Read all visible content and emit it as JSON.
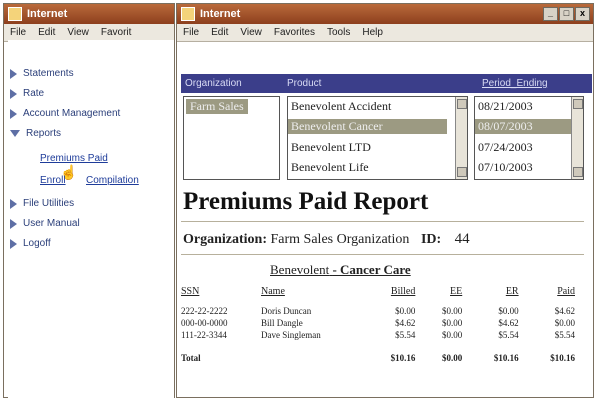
{
  "left_window": {
    "title": "Internet",
    "menu": [
      "File",
      "Edit",
      "View",
      "Favorit"
    ]
  },
  "right_window": {
    "title": "Internet",
    "menu": [
      "File",
      "Edit",
      "View",
      "Favorites",
      "Tools",
      "Help"
    ],
    "controls": [
      "_",
      "□",
      "x"
    ]
  },
  "sidebar": {
    "statements": "Statements",
    "rate": "Rate",
    "account_management": "Account Management",
    "reports": "Reports",
    "premiums_paid": "Premiums Paid",
    "enroll": "Enroll",
    "compilation": "Compilation",
    "file_utilities": "File Utilities",
    "user_manual": "User Manual",
    "logoff": "Logoff"
  },
  "filters": {
    "header": {
      "organization": "Organization",
      "product": "Product",
      "period": "Period_Ending"
    },
    "organization_options": [
      "Farm Sales"
    ],
    "product_options": [
      "Benevolent Accident",
      "Benevolent Cancer",
      "Benevolent LTD",
      "Benevolent Life"
    ],
    "period_options": [
      "08/21/2003",
      "08/07/2003",
      "07/24/2003",
      "07/10/2003"
    ]
  },
  "report": {
    "title": "Premiums Paid Report",
    "org_label": "Organization:",
    "org_value": "Farm Sales Organization",
    "id_label": "ID:",
    "id_value": "44",
    "subtitle_prefix": "Benevolent",
    "subtitle_product": "- Cancer Care",
    "columns": [
      "SSN",
      "Name",
      "Billed",
      "EE",
      "ER",
      "Paid"
    ],
    "rows": [
      [
        "222-22-2222",
        "Doris Duncan",
        "$0.00",
        "$0.00",
        "$0.00",
        "$4.62"
      ],
      [
        "000-00-0000",
        "Bill Dangle",
        "$4.62",
        "$0.00",
        "$4.62",
        "$0.00"
      ],
      [
        "111-22-3344",
        "Dave Singleman",
        "$5.54",
        "$0.00",
        "$5.54",
        "$5.54"
      ]
    ],
    "total": [
      "Total",
      "$10.16",
      "$0.00",
      "$10.16",
      "$10.16"
    ]
  }
}
